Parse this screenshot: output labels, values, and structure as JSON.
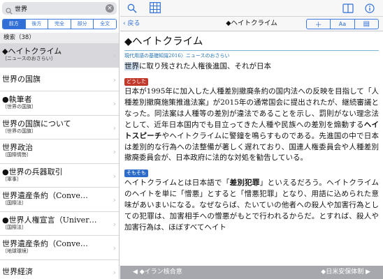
{
  "search": {
    "query": "世界"
  },
  "mode_tabs": [
    "前方",
    "後方",
    "完全",
    "部分",
    "全文"
  ],
  "results": {
    "header": "検索（38）",
    "items": [
      {
        "title": "◆ヘイトクライム",
        "subtitle": "〔ニュースのおさらい〕",
        "selected": true
      },
      {
        "title": "世界の国旗",
        "subtitle": ""
      },
      {
        "title": "●執筆者",
        "subtitle": "〔世界の国旗〕"
      },
      {
        "title": "世界の国旗について",
        "subtitle": "〔世界の国旗〕"
      },
      {
        "title": "世界政治",
        "subtitle": "〔国際情勢〕"
      },
      {
        "title": "●世界の兵器取引",
        "subtitle": "〔軍事〕"
      },
      {
        "title": "世界遺産条約（Conve…",
        "subtitle": "〔国際法〕"
      },
      {
        "title": "●世界人権宣言（Univer…",
        "subtitle": "〔国際法〕"
      },
      {
        "title": "世界遺産条約（Conve…",
        "subtitle": "〔地球環境〕"
      },
      {
        "title": "世界経済",
        "subtitle": ""
      }
    ]
  },
  "nav": {
    "back_label": "戻る",
    "title": "◆ヘイトクライム",
    "tools": [
      "＋",
      "Aa",
      "▤"
    ]
  },
  "article": {
    "headword": "◆ヘイトクライム",
    "source": "現代用語の基礎知識2016〉ニュースのおさらい",
    "lead_highlight": "世界",
    "lead_rest": "に取り残された人権後進国、それが日本",
    "badge1": "どうした",
    "para1": [
      {
        "t": "日本が1995年に加入した人種差別撤廃条約の国内法への反映を目指して「人種差別撤廃施策推進法案」が2015年の通常国会に提出されたが、継続審議となった。同法案は人種等の差別が違法であることを示し、罰則がない理念法として、近年日本国内でも目立ってきた人種や民族への差別を煽動する"
      },
      {
        "t": "ヘイトスピーチ",
        "b": true
      },
      {
        "t": "やヘイトクライムに警鐘を鳴らすものである。先進国の中で日本は差別的な行為への法整備が著しく遅れており、国連人権委員会や人種差別撤廃委員会が、日本政府に法的な対処を勧告している。"
      }
    ],
    "badge2": "そもそも",
    "para2": [
      {
        "t": "ヘイトクライムとは日本語で「"
      },
      {
        "t": "差別犯罪",
        "b": true
      },
      {
        "t": "」といえるだろう。ヘイトクライムのヘイトを単に「憎悪」とすると「憎悪犯罪」となり、用語に込められた意味があいまいになる。なぜならば、たいていの他者への殺人や加害行為としての犯罪は、加害相手への憎悪がもとで行われるからだ。とすれば、殺人や加害行為は、ほぼすべてヘイト"
      }
    ]
  },
  "bottom": {
    "prev": "◀ ◆イラン核合意",
    "next": "◆日米安保体制 ▶"
  },
  "colors": {
    "accent": "#2f6fd6",
    "badge_red": "#c0392b",
    "badge_blue": "#2d6dc9",
    "bottom_bar": "#a7a8ad"
  }
}
